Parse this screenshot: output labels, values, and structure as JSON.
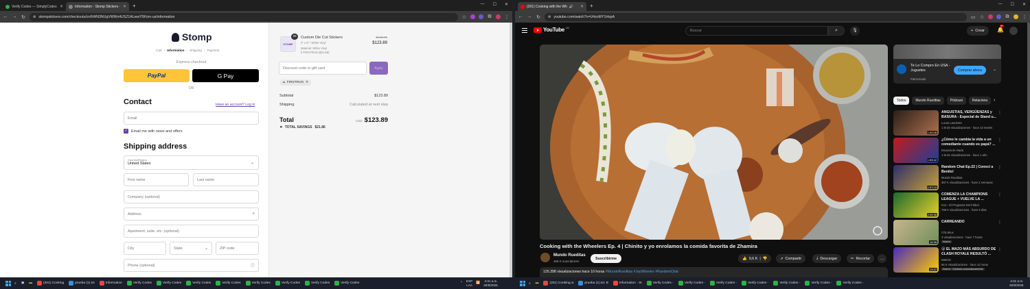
{
  "left_browser": {
    "tabs": [
      {
        "title": "Verify Codes — SimplyCodes",
        "color": "#2db24a"
      },
      {
        "title": "Information - Stomp Stickers -",
        "color": "#888888",
        "active": true
      }
    ],
    "url": "stompstickers.com/checkouts/cn/hWN3NUgVWWx4USZ1ALwwY5K/en-us/information"
  },
  "checkout": {
    "brand": "Stomp",
    "breadcrumb": [
      "Cart",
      "Information",
      "Shipping",
      "Payment"
    ],
    "express_checkout": "Express checkout",
    "paypal_label": "PayPal",
    "gpay_label": "G Pay",
    "or": "OR",
    "contact_heading": "Contact",
    "login_link": "Have an account? Log in",
    "email_placeholder": "Email",
    "news_label": "Email me with news and offers",
    "shipping_heading": "Shipping address",
    "country_label": "Country/Region",
    "country_value": "United States",
    "first_name": "First name",
    "last_name": "Last name",
    "company": "Company (optional)",
    "address": "Address",
    "apartment": "Apartment, suite, etc. (optional)",
    "city": "City",
    "state": "State",
    "zip": "ZIP code",
    "phone": "Phone (optional)"
  },
  "summary": {
    "qty": "25",
    "product_name": "Custom Die Cut Stickers",
    "product_size": "2\" x 6\" / White Vinyl",
    "product_material": "Material: White Vinyl",
    "product_discount": "FIRSTRUN ($21.86)",
    "price_old": "$145.75",
    "price_new": "$123.89",
    "discount_placeholder": "Discount code or gift card",
    "apply": "Apply",
    "code": "FIRSTRUN",
    "subtotal_label": "Subtotal",
    "subtotal": "$123.89",
    "shipping_label": "Shipping",
    "shipping": "Calculated at next step",
    "total_label": "Total",
    "currency": "USD",
    "total": "$123.89",
    "savings_label": "TOTAL SAVINGS",
    "savings": "$21.86"
  },
  "right_browser": {
    "tabs": [
      {
        "title": "(201) Cooking with the Wh",
        "color": "#ff0000",
        "active": true
      }
    ],
    "url": "youtube.com/watch?v=U4znMY1HxpA"
  },
  "youtube": {
    "search_placeholder": "Buscar",
    "create": "Crear",
    "notif_count": "9+",
    "video_title": "Cooking with the Wheelers Ep. 4 | Chinito y yo enrolamos la comida favorita de Zhamira",
    "channel": "Mundo Rueditas",
    "subs": "466 K suscriptores",
    "subscribe": "Suscribirme",
    "likes": "9,6 K",
    "share": "Compartir",
    "download": "Descargar",
    "clip": "Recortar",
    "views": "125.398 visualizaciones  hace 10 horas",
    "hashtags": "#MundoRueditas #JayWheeler #RandomChat",
    "ad": {
      "title": "Te Lo Compro En USA - Juguetes",
      "sponsor": "Patrocinado",
      "button": "Comprar ahora"
    },
    "chips": [
      "Todos",
      "Mundo Rueditas",
      "Pódcast",
      "Relaciona"
    ],
    "recs": [
      {
        "title": "ANGUSTIAS, VERGÜENZAS y BASURA - Especial de Stand u...",
        "channel": "Lucas Lauriente",
        "meta": "1 M de visualizaciones · hace 13 meses",
        "dur": "1:02:06",
        "c1": "#2a1f18",
        "c2": "#b07050"
      },
      {
        "title": "¿Cómo le cambia la vida a un comediante cuando es papá? ...",
        "channel": "Escuela de Nada",
        "meta": "1 M de visualizaciones · hace 1 año",
        "dur": "1:59:42",
        "c1": "#c21a1a",
        "c2": "#1d3f9a"
      },
      {
        "title": "Random Chat Ep.22 | Conocí a Benito!",
        "channel": "Mundo Rueditas",
        "meta": "367 K visualizaciones · hace 2 semanas",
        "dur": "1:57:10",
        "c1": "#2e2f6a",
        "c2": "#c7a23a"
      },
      {
        "title": "COMENZA LA CHAMPIONS LEAGUE + VUELVE LA ...",
        "channel": "K12 - El Programa Del Fútbol",
        "meta": "788 K visualizaciones · hace 9 días",
        "dur": "2:34:38",
        "c1": "#1d6a2e",
        "c2": "#e6d12a"
      },
      {
        "title": "CARREANDO",
        "channel": "COLdeux",
        "meta": "3 visualizaciones · hace 7 horas",
        "dur": "16:36",
        "c1": "#c9b48d",
        "c2": "#6f8f5a",
        "nuevo": "Nuevo"
      },
      {
        "title": "😮 EL MAZO MÁS ABSURDO DE CLASH ROYALE RESULTÓ ...",
        "channel": "Bale0G",
        "meta": "56 K visualizaciones · hace 11 horas",
        "dur": "13:37",
        "c1": "#4a2bbd",
        "c2": "#ffcc00",
        "nuevo": "Nuevo  · Doblado automáticamente"
      }
    ]
  },
  "taskbar": {
    "left_items": [
      "(201) Cooking",
      "prueba (1).txt",
      "Information",
      "Verify Codes",
      "Verify Codes",
      "Verify Codes",
      "Verify Codes",
      "Verify Codes",
      "Verify Codes",
      "Verify Codes",
      "Verify Codes"
    ],
    "right_items": [
      "(201) Cooking w",
      "prueba (1).txt: B",
      "Information - St",
      "Verify Codes -",
      "Verify Codes -",
      "Verify Codes -",
      "Verify Codes -",
      "Verify Codes -",
      "Verify Codes -",
      "Verify Codes -"
    ],
    "lang": "ESP\nLAA",
    "time_left": "4:31 a.m.\n25/9/2025",
    "time_right": "4:31 a.m.\n25/9/2025"
  }
}
